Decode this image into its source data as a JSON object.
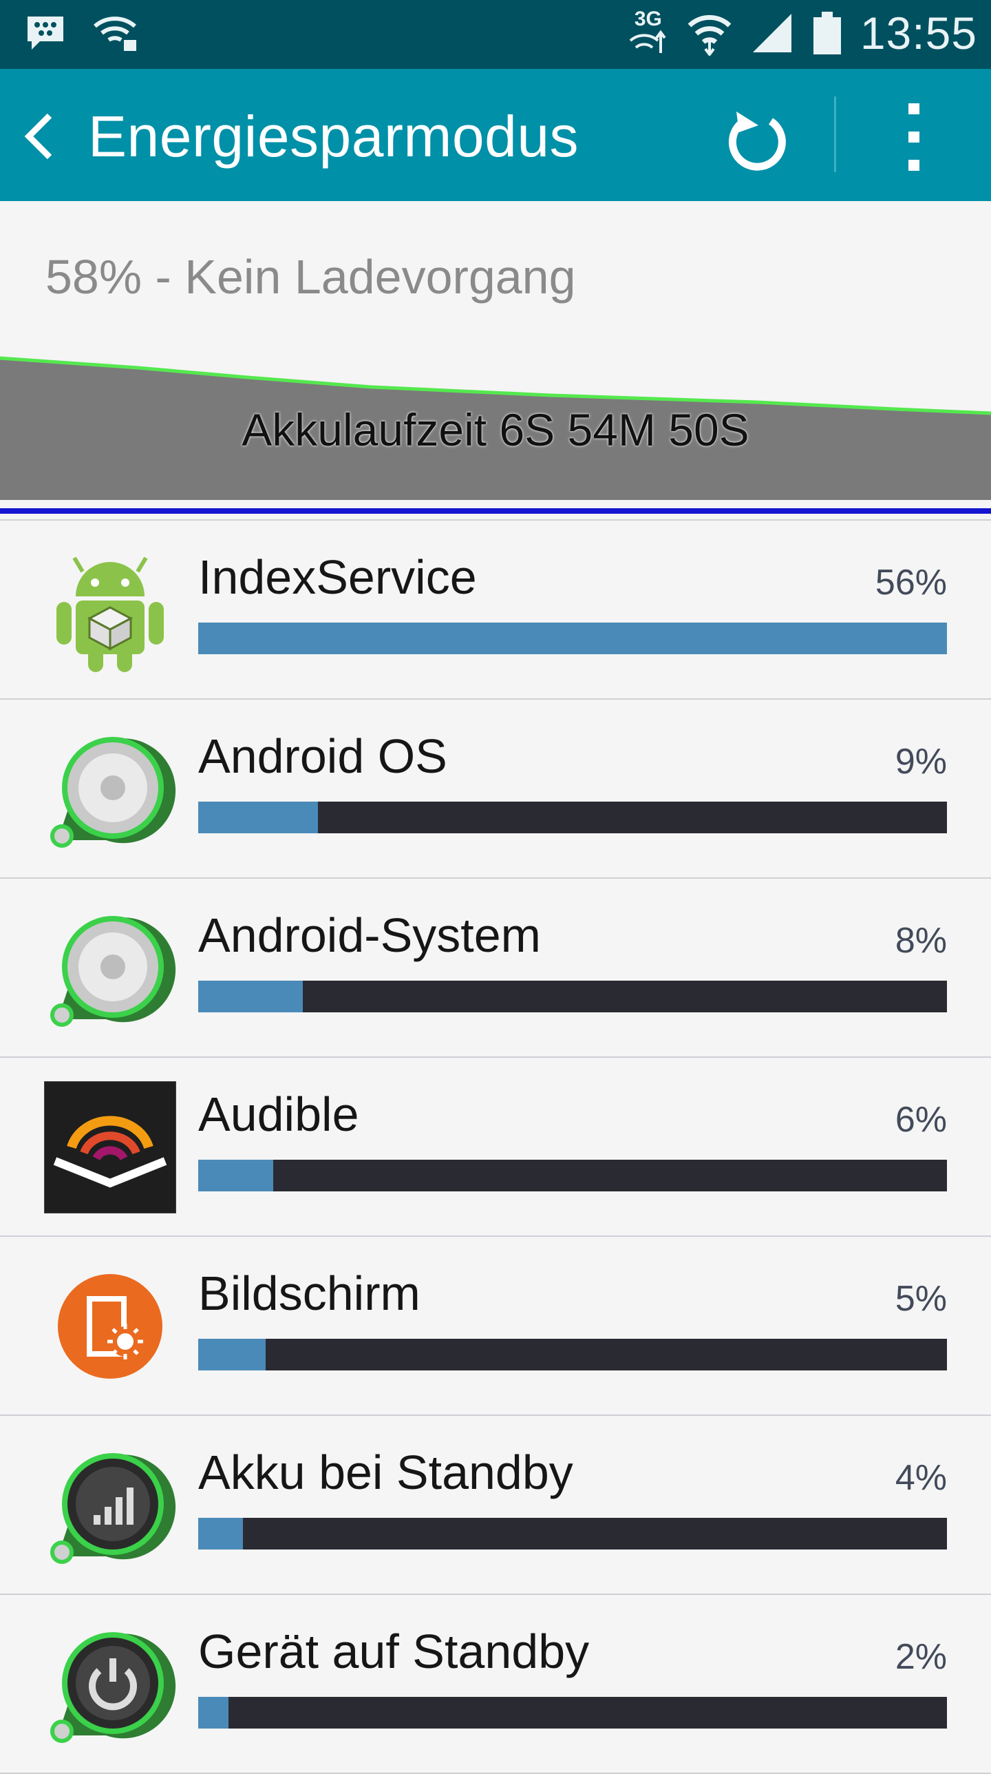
{
  "status_bar": {
    "time": "13:55",
    "network_label": "3G",
    "icons": [
      "bbm-icon",
      "wifi-lock-icon",
      "3g-data-icon",
      "wifi-icon",
      "signal-icon",
      "battery-icon"
    ]
  },
  "action_bar": {
    "title": "Energiesparmodus",
    "back_icon": "chevron-left-icon",
    "refresh_icon": "refresh-icon",
    "more_icon": "more-vert-icon"
  },
  "summary": {
    "text": "58% - Kein Ladevorgang"
  },
  "graph": {
    "label": "Akkulaufzeit 6S 54M 50S",
    "line_color": "#55e84f",
    "fill_color": "#7a7a7a"
  },
  "usage": [
    {
      "name": "IndexService",
      "percent_label": "56%",
      "value": 1.0,
      "icon": "android-package-icon"
    },
    {
      "name": "Android OS",
      "percent_label": "9%",
      "value": 0.16,
      "icon": "android-os-icon"
    },
    {
      "name": "Android-System",
      "percent_label": "8%",
      "value": 0.14,
      "icon": "android-system-icon"
    },
    {
      "name": "Audible",
      "percent_label": "6%",
      "value": 0.1,
      "icon": "audible-icon"
    },
    {
      "name": "Bildschirm",
      "percent_label": "5%",
      "value": 0.09,
      "icon": "screen-brightness-icon"
    },
    {
      "name": "Akku bei Standby",
      "percent_label": "4%",
      "value": 0.06,
      "icon": "cell-standby-icon"
    },
    {
      "name": "Gerät auf Standby",
      "percent_label": "2%",
      "value": 0.04,
      "icon": "power-standby-icon"
    }
  ],
  "colors": {
    "status_bar": "#00505f",
    "action_bar": "#0090a8",
    "bar_fill": "#4a8ab8",
    "bar_track": "#2a2a32"
  }
}
